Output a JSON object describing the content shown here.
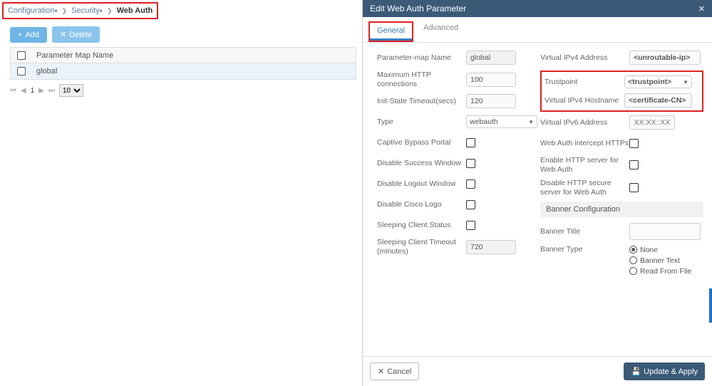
{
  "breadcrumb": {
    "l1": "Configuration",
    "l2": "Security",
    "current": "Web Auth"
  },
  "actions": {
    "add": "Add",
    "delete": "Delete"
  },
  "table": {
    "header": "Parameter Map Name",
    "row0": "global"
  },
  "pager": {
    "page": "1",
    "size": "10"
  },
  "panel": {
    "title": "Edit Web Auth Parameter",
    "tabs": {
      "general": "General",
      "advanced": "Advanced"
    },
    "left": {
      "pm_name_l": "Parameter-map Name",
      "pm_name_v": "global",
      "max_http_l": "Maximum HTTP connections",
      "max_http_v": "100",
      "init_l": "Init-State Timeout(secs)",
      "init_v": "120",
      "type_l": "Type",
      "type_v": "webauth",
      "captive_l": "Captive Bypass Portal",
      "dsw_l": "Disable Success Window",
      "dlw_l": "Disable Logout Window",
      "dcl_l": "Disable Cisco Logo",
      "scs_l": "Sleeping Client Status",
      "sct_l": "Sleeping Client Timeout (minutes)",
      "sct_v": "720"
    },
    "right": {
      "v4addr_l": "Virtual IPv4 Address",
      "v4addr_v": "<unroutable-ip>",
      "tp_l": "Trustpoint",
      "tp_v": "<trustpoint>",
      "v4host_l": "Virtual IPv4 Hostname",
      "v4host_v": "<certificate-CN>",
      "v6addr_l": "Virtual IPv6 Address",
      "v6addr_ph": "XX:XX::XX",
      "wai_l": "Web Auth intercept HTTPs",
      "ehttp_l": "Enable HTTP server for Web Auth",
      "dhttps_l": "Disable HTTP secure server for Web Auth",
      "bcfg": "Banner Configuration",
      "btitle_l": "Banner Title",
      "btype_l": "Banner Type",
      "r_none": "None",
      "r_text": "Banner Text",
      "r_file": "Read From File"
    },
    "footer": {
      "cancel": "Cancel",
      "apply": "Update & Apply"
    }
  }
}
